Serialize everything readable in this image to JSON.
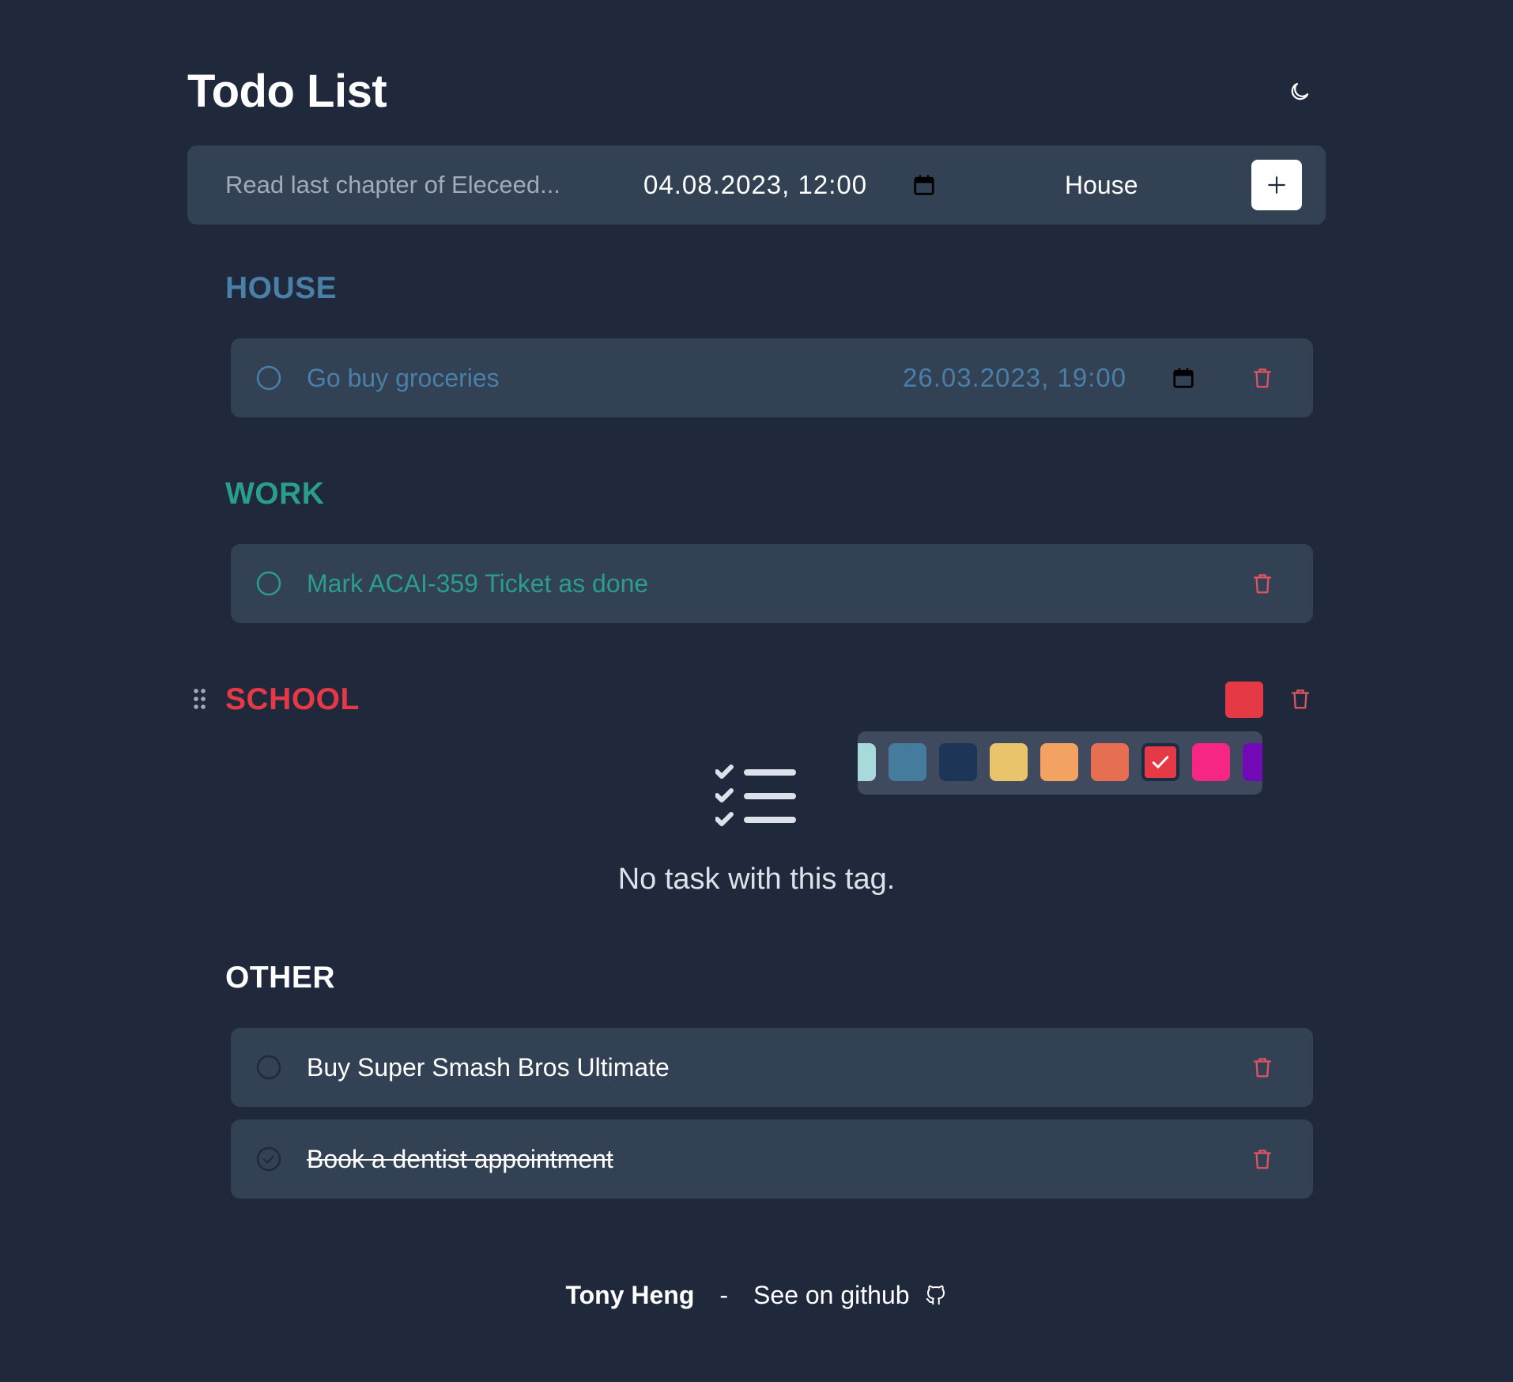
{
  "app": {
    "title": "Todo List",
    "theme_toggle_icon": "moon-icon"
  },
  "add_bar": {
    "task_placeholder": "Read last chapter of Eleceed...",
    "date_value": "04.08.2023, 12:00",
    "tag_value": "House",
    "add_icon": "plus-icon"
  },
  "colors": {
    "background": "#1f293b",
    "card": "#334155",
    "house": "#4a7fa8",
    "work": "#2a9d8f",
    "school": "#e63946",
    "other": "#ffffff",
    "trash": "#e05561"
  },
  "sections": {
    "house": {
      "title": "HOUSE",
      "tasks": [
        {
          "label": "Go buy groceries",
          "due": "26.03.2023, 19:00",
          "done": false
        }
      ]
    },
    "work": {
      "title": "WORK",
      "tasks": [
        {
          "label": "Mark ACAI-359 Ticket as done",
          "done": false
        }
      ]
    },
    "school": {
      "title": "SCHOOL",
      "empty_text": "No task with this tag.",
      "palette": [
        "#a8dadc",
        "#457b9d",
        "#1d3557",
        "#e9c46a",
        "#f4a261",
        "#e76f51",
        "#e63946",
        "#f72585",
        "#7209b7"
      ],
      "selected_color": "#e63946"
    },
    "other": {
      "title": "OTHER",
      "tasks": [
        {
          "label": "Buy Super Smash Bros Ultimate",
          "done": false
        },
        {
          "label": "Book a dentist appointment",
          "done": true
        }
      ]
    }
  },
  "footer": {
    "author": "Tony Heng",
    "separator": "-",
    "github_label": "See on github"
  }
}
